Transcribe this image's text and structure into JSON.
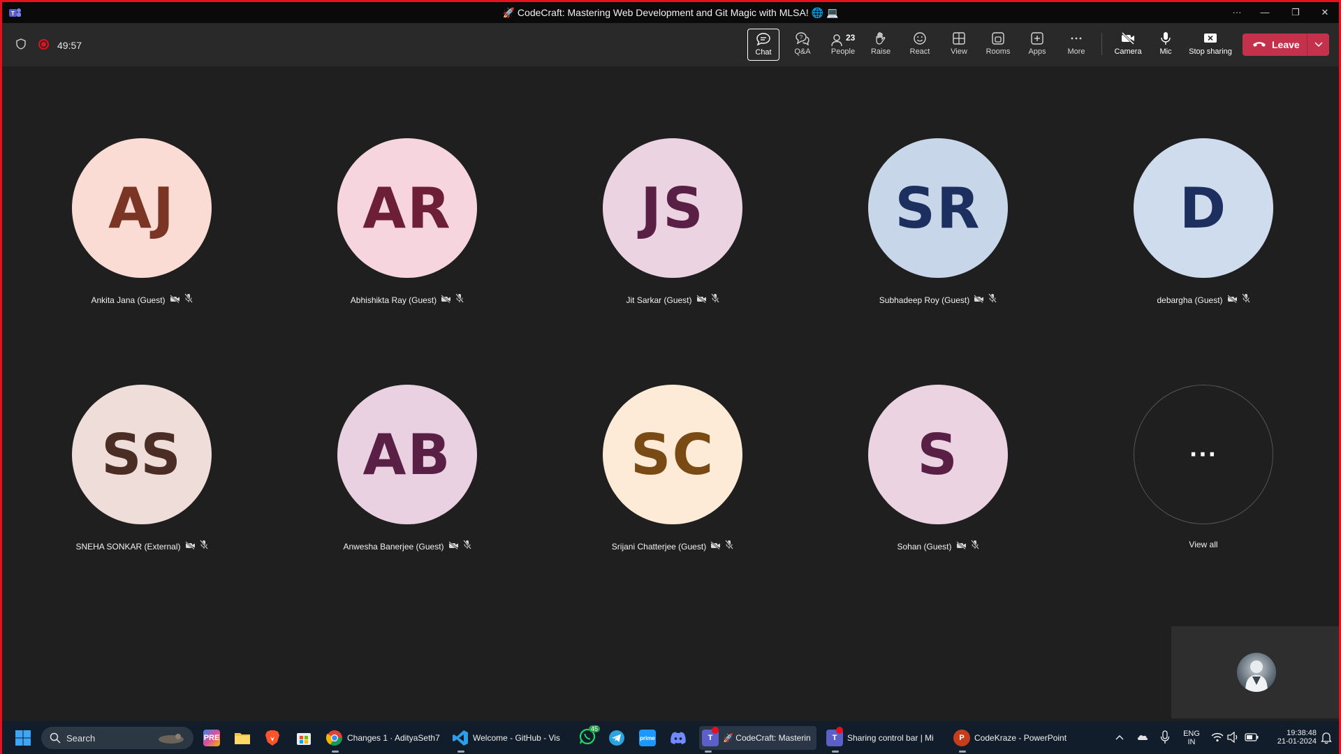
{
  "window": {
    "title": "🚀 CodeCraft: Mastering Web Development and Git Magic with MLSA! 🌐 💻",
    "controls": {
      "more": "···",
      "minimize": "—",
      "restore": "❐",
      "close": "✕"
    }
  },
  "toolbar": {
    "timer": "49:57",
    "buttons": {
      "chat": "Chat",
      "qa": "Q&A",
      "people": "People",
      "people_count": "23",
      "raise": "Raise",
      "react": "React",
      "view": "View",
      "rooms": "Rooms",
      "apps": "Apps",
      "more": "More",
      "camera": "Camera",
      "mic": "Mic",
      "stop_sharing": "Stop sharing",
      "leave": "Leave"
    }
  },
  "participants": [
    {
      "initials": "AJ",
      "name": "Ankita Jana (Guest)",
      "bg": "#fbdcd5",
      "fg": "#7a3524"
    },
    {
      "initials": "AR",
      "name": "Abhishikta Ray (Guest)",
      "bg": "#f6d5df",
      "fg": "#6d1f37"
    },
    {
      "initials": "JS",
      "name": "Jit Sarkar (Guest)",
      "bg": "#ecd3e2",
      "fg": "#5a1f45"
    },
    {
      "initials": "SR",
      "name": "Subhadeep Roy (Guest)",
      "bg": "#c8d6ea",
      "fg": "#1c2f5e"
    },
    {
      "initials": "D",
      "name": "debargha (Guest)",
      "bg": "#cfdcee",
      "fg": "#1c2f5e"
    },
    {
      "initials": "SS",
      "name": "SNEHA SONKAR (External)",
      "bg": "#eeddd8",
      "fg": "#4a2e25"
    },
    {
      "initials": "AB",
      "name": "Anwesha Banerjee (Guest)",
      "bg": "#ead1e1",
      "fg": "#5a1f45"
    },
    {
      "initials": "SC",
      "name": "Srijani Chatterjee (Guest)",
      "bg": "#fdebd7",
      "fg": "#7a4a14"
    },
    {
      "initials": "S",
      "name": "Sohan (Guest)",
      "bg": "#ecd3e2",
      "fg": "#5a1f45"
    }
  ],
  "view_all": {
    "glyph": "···",
    "label": "View all"
  },
  "taskbar": {
    "search_placeholder": "Search",
    "items": {
      "chrome_label": "Changes 1 · AdityaSeth7",
      "vscode_label": "Welcome - GitHub - Vis",
      "whatsapp_badge": "45",
      "teams_meeting_label": "🚀 CodeCraft: Masterin",
      "teams_sharing_label": "Sharing control bar | Mi",
      "powerpoint_label": "CodeKraze - PowerPoint"
    },
    "tray": {
      "lang_top": "ENG",
      "lang_bottom": "IN",
      "time": "19:38:48",
      "date": "21-01-2024"
    }
  },
  "colors": {
    "border_red": "#e8101b",
    "leave_red": "#c4314b",
    "stage_bg": "#1f1f1f",
    "toolbar_bg": "#292929"
  }
}
